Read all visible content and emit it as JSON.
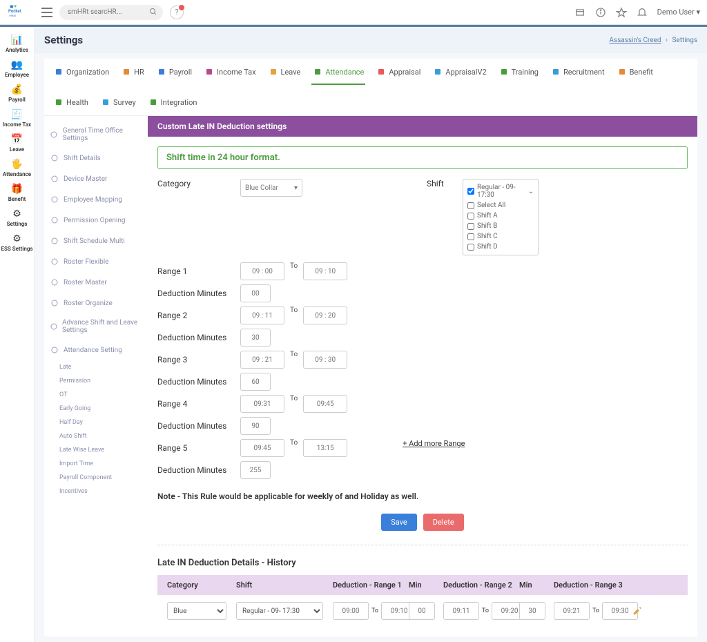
{
  "top": {
    "search_placeholder": "smHRt searcHR...",
    "user": "Demo User"
  },
  "breadcrumb": {
    "org": "Assassin's Creed",
    "page": "Settings"
  },
  "page_title": "Settings",
  "rail": [
    {
      "label": "Analytics"
    },
    {
      "label": "Employee"
    },
    {
      "label": "Payroll"
    },
    {
      "label": "Income Tax"
    },
    {
      "label": "Leave"
    },
    {
      "label": "Attendance"
    },
    {
      "label": "Benefit"
    },
    {
      "label": "Settings"
    },
    {
      "label": "ESS Settings"
    }
  ],
  "tabs": [
    {
      "label": "Organization"
    },
    {
      "label": "HR"
    },
    {
      "label": "Payroll"
    },
    {
      "label": "Income Tax"
    },
    {
      "label": "Leave"
    },
    {
      "label": "Attendance",
      "active": true
    },
    {
      "label": "Appraisal"
    },
    {
      "label": "AppraisalV2"
    },
    {
      "label": "Training"
    },
    {
      "label": "Recruitment"
    },
    {
      "label": "Benefit"
    },
    {
      "label": "Health"
    },
    {
      "label": "Survey"
    },
    {
      "label": "Integration"
    }
  ],
  "sidemenu": [
    "General Time Office Settings",
    "Shift Details",
    "Device Master",
    "Employee Mapping",
    "Permission Opening",
    "Shift Schedule Multi",
    "Roster Flexible",
    "Roster Master",
    "Roster Organize",
    "Advance Shift and Leave Settings",
    "Attendance Setting"
  ],
  "submenu": [
    "Late",
    "Permission",
    "OT",
    "Early Going",
    "Half Day",
    "Auto Shift",
    "Late Wise Leave",
    "Import Time",
    "Payroll Component",
    "Incentives"
  ],
  "panel": {
    "title": "Custom Late IN Deduction settings",
    "note_box": "Shift time in 24 hour format.",
    "category_label": "Category",
    "category_value": "Blue Collar",
    "shift_label": "Shift",
    "shift_selected": "Regular - 09- 17:30",
    "shift_options": [
      "Select  All",
      "Shift A",
      "Shift B",
      "Shift C",
      "Shift D"
    ],
    "ranges": [
      {
        "label": "Range 1",
        "from": "09 : 00",
        "to": "09 : 10",
        "ded_label": "Deduction Minutes",
        "ded": "00"
      },
      {
        "label": "Range 2",
        "from": "09 : 11",
        "to": "09 : 20",
        "ded_label": "Deduction Minutes",
        "ded": "30"
      },
      {
        "label": "Range 3",
        "from": "09 : 21",
        "to": "09 : 30",
        "ded_label": "Deduction Minutes",
        "ded": "60"
      },
      {
        "label": "Range 4",
        "from": "09:31",
        "to": "09:45",
        "ded_label": "Deduction Minutes",
        "ded": "90"
      },
      {
        "label": "Range 5",
        "from": "09:45",
        "to": "13:15",
        "ded_label": "Deduction Minutes",
        "ded": "255"
      }
    ],
    "to_label": "To",
    "add_more": "+ Add more Range",
    "note_text": "Note - This Rule would be applicable for weekly of and Holiday as well.",
    "save": "Save",
    "delete": "Delete"
  },
  "history": {
    "title": "Late IN Deduction Details - History",
    "headers": {
      "cat": "Category",
      "shift": "Shift",
      "r1": "Deduction  - Range 1",
      "min": "Min",
      "r2": "Deduction - Range 2",
      "r3": "Deduction - Range 3"
    },
    "row": {
      "category": "Blue",
      "shift": "Regular - 09- 17:30",
      "r1f": "09:00",
      "r1t": "09:10",
      "m1": "00",
      "r2f": "09:11",
      "r2t": "09:20",
      "m2": "30",
      "r3f": "09:21",
      "r3t": "09:30",
      "to": "To"
    }
  }
}
